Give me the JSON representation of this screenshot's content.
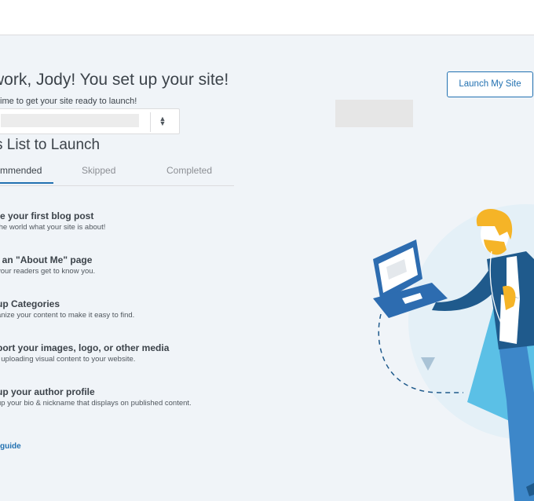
{
  "header": {
    "greeting": "work, Jody! You set up your site!",
    "subtitle": "ime to get your site ready to launch!",
    "list_title": "s List to Launch"
  },
  "site_selector": {
    "stepper_up": "▲",
    "stepper_down": "▼"
  },
  "tabs": [
    {
      "label": "mmended",
      "active": true
    },
    {
      "label": "Skipped",
      "active": false
    },
    {
      "label": "Completed",
      "active": false
    }
  ],
  "tasks": [
    {
      "title": "te your first blog post",
      "description": "the world what your site is about!"
    },
    {
      "title": "l an \"About Me\" page",
      "description": "your readers get to know you."
    },
    {
      "title": "up Categories",
      "description": "anize your content to make it easy to find."
    },
    {
      "title": "port your images, logo, or other media",
      "description": "t uploading visual content to your website."
    },
    {
      "title": "up your author profile",
      "description": "up your bio & nickname that displays on published content."
    }
  ],
  "guide_link": "guide",
  "launch_button": "Launch My Site",
  "colors": {
    "accent": "#2271b1",
    "background": "#f0f4f8",
    "hair": "#f5b427",
    "shirt": "#1f5a8c",
    "laptop": "#2d6cb0",
    "shape": "#5bc0e6"
  },
  "icons": [
    "chevron-up-down-icon"
  ]
}
